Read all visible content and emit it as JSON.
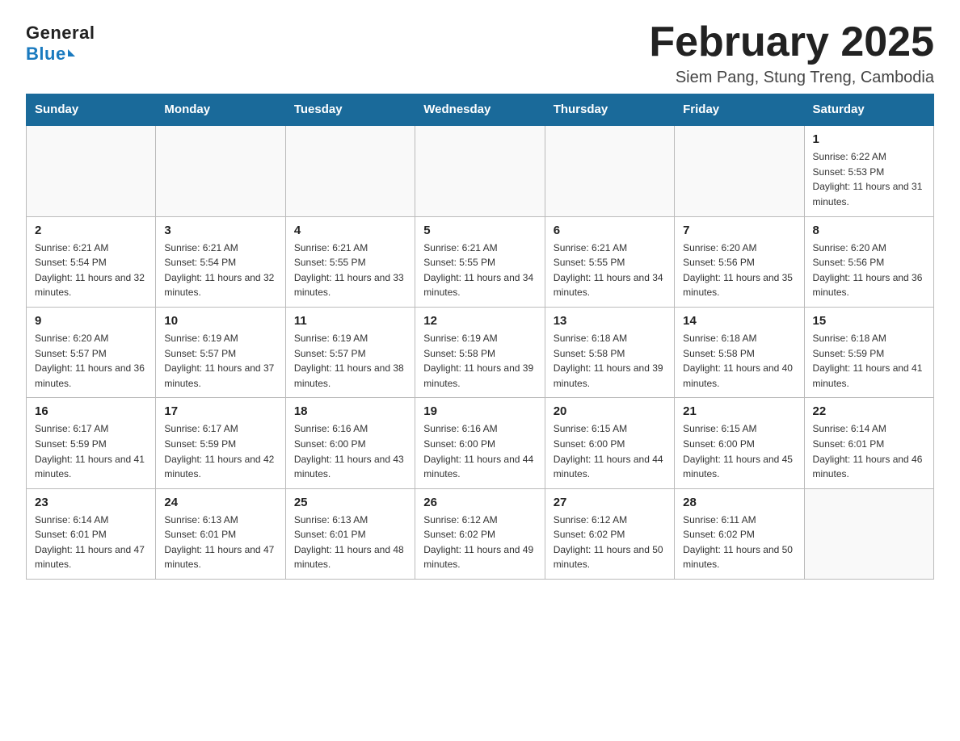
{
  "logo": {
    "general": "General",
    "blue": "Blue"
  },
  "title": "February 2025",
  "subtitle": "Siem Pang, Stung Treng, Cambodia",
  "calendar": {
    "headers": [
      "Sunday",
      "Monday",
      "Tuesday",
      "Wednesday",
      "Thursday",
      "Friday",
      "Saturday"
    ],
    "weeks": [
      [
        {
          "day": "",
          "info": ""
        },
        {
          "day": "",
          "info": ""
        },
        {
          "day": "",
          "info": ""
        },
        {
          "day": "",
          "info": ""
        },
        {
          "day": "",
          "info": ""
        },
        {
          "day": "",
          "info": ""
        },
        {
          "day": "1",
          "info": "Sunrise: 6:22 AM\nSunset: 5:53 PM\nDaylight: 11 hours and 31 minutes."
        }
      ],
      [
        {
          "day": "2",
          "info": "Sunrise: 6:21 AM\nSunset: 5:54 PM\nDaylight: 11 hours and 32 minutes."
        },
        {
          "day": "3",
          "info": "Sunrise: 6:21 AM\nSunset: 5:54 PM\nDaylight: 11 hours and 32 minutes."
        },
        {
          "day": "4",
          "info": "Sunrise: 6:21 AM\nSunset: 5:55 PM\nDaylight: 11 hours and 33 minutes."
        },
        {
          "day": "5",
          "info": "Sunrise: 6:21 AM\nSunset: 5:55 PM\nDaylight: 11 hours and 34 minutes."
        },
        {
          "day": "6",
          "info": "Sunrise: 6:21 AM\nSunset: 5:55 PM\nDaylight: 11 hours and 34 minutes."
        },
        {
          "day": "7",
          "info": "Sunrise: 6:20 AM\nSunset: 5:56 PM\nDaylight: 11 hours and 35 minutes."
        },
        {
          "day": "8",
          "info": "Sunrise: 6:20 AM\nSunset: 5:56 PM\nDaylight: 11 hours and 36 minutes."
        }
      ],
      [
        {
          "day": "9",
          "info": "Sunrise: 6:20 AM\nSunset: 5:57 PM\nDaylight: 11 hours and 36 minutes."
        },
        {
          "day": "10",
          "info": "Sunrise: 6:19 AM\nSunset: 5:57 PM\nDaylight: 11 hours and 37 minutes."
        },
        {
          "day": "11",
          "info": "Sunrise: 6:19 AM\nSunset: 5:57 PM\nDaylight: 11 hours and 38 minutes."
        },
        {
          "day": "12",
          "info": "Sunrise: 6:19 AM\nSunset: 5:58 PM\nDaylight: 11 hours and 39 minutes."
        },
        {
          "day": "13",
          "info": "Sunrise: 6:18 AM\nSunset: 5:58 PM\nDaylight: 11 hours and 39 minutes."
        },
        {
          "day": "14",
          "info": "Sunrise: 6:18 AM\nSunset: 5:58 PM\nDaylight: 11 hours and 40 minutes."
        },
        {
          "day": "15",
          "info": "Sunrise: 6:18 AM\nSunset: 5:59 PM\nDaylight: 11 hours and 41 minutes."
        }
      ],
      [
        {
          "day": "16",
          "info": "Sunrise: 6:17 AM\nSunset: 5:59 PM\nDaylight: 11 hours and 41 minutes."
        },
        {
          "day": "17",
          "info": "Sunrise: 6:17 AM\nSunset: 5:59 PM\nDaylight: 11 hours and 42 minutes."
        },
        {
          "day": "18",
          "info": "Sunrise: 6:16 AM\nSunset: 6:00 PM\nDaylight: 11 hours and 43 minutes."
        },
        {
          "day": "19",
          "info": "Sunrise: 6:16 AM\nSunset: 6:00 PM\nDaylight: 11 hours and 44 minutes."
        },
        {
          "day": "20",
          "info": "Sunrise: 6:15 AM\nSunset: 6:00 PM\nDaylight: 11 hours and 44 minutes."
        },
        {
          "day": "21",
          "info": "Sunrise: 6:15 AM\nSunset: 6:00 PM\nDaylight: 11 hours and 45 minutes."
        },
        {
          "day": "22",
          "info": "Sunrise: 6:14 AM\nSunset: 6:01 PM\nDaylight: 11 hours and 46 minutes."
        }
      ],
      [
        {
          "day": "23",
          "info": "Sunrise: 6:14 AM\nSunset: 6:01 PM\nDaylight: 11 hours and 47 minutes."
        },
        {
          "day": "24",
          "info": "Sunrise: 6:13 AM\nSunset: 6:01 PM\nDaylight: 11 hours and 47 minutes."
        },
        {
          "day": "25",
          "info": "Sunrise: 6:13 AM\nSunset: 6:01 PM\nDaylight: 11 hours and 48 minutes."
        },
        {
          "day": "26",
          "info": "Sunrise: 6:12 AM\nSunset: 6:02 PM\nDaylight: 11 hours and 49 minutes."
        },
        {
          "day": "27",
          "info": "Sunrise: 6:12 AM\nSunset: 6:02 PM\nDaylight: 11 hours and 50 minutes."
        },
        {
          "day": "28",
          "info": "Sunrise: 6:11 AM\nSunset: 6:02 PM\nDaylight: 11 hours and 50 minutes."
        },
        {
          "day": "",
          "info": ""
        }
      ]
    ]
  }
}
